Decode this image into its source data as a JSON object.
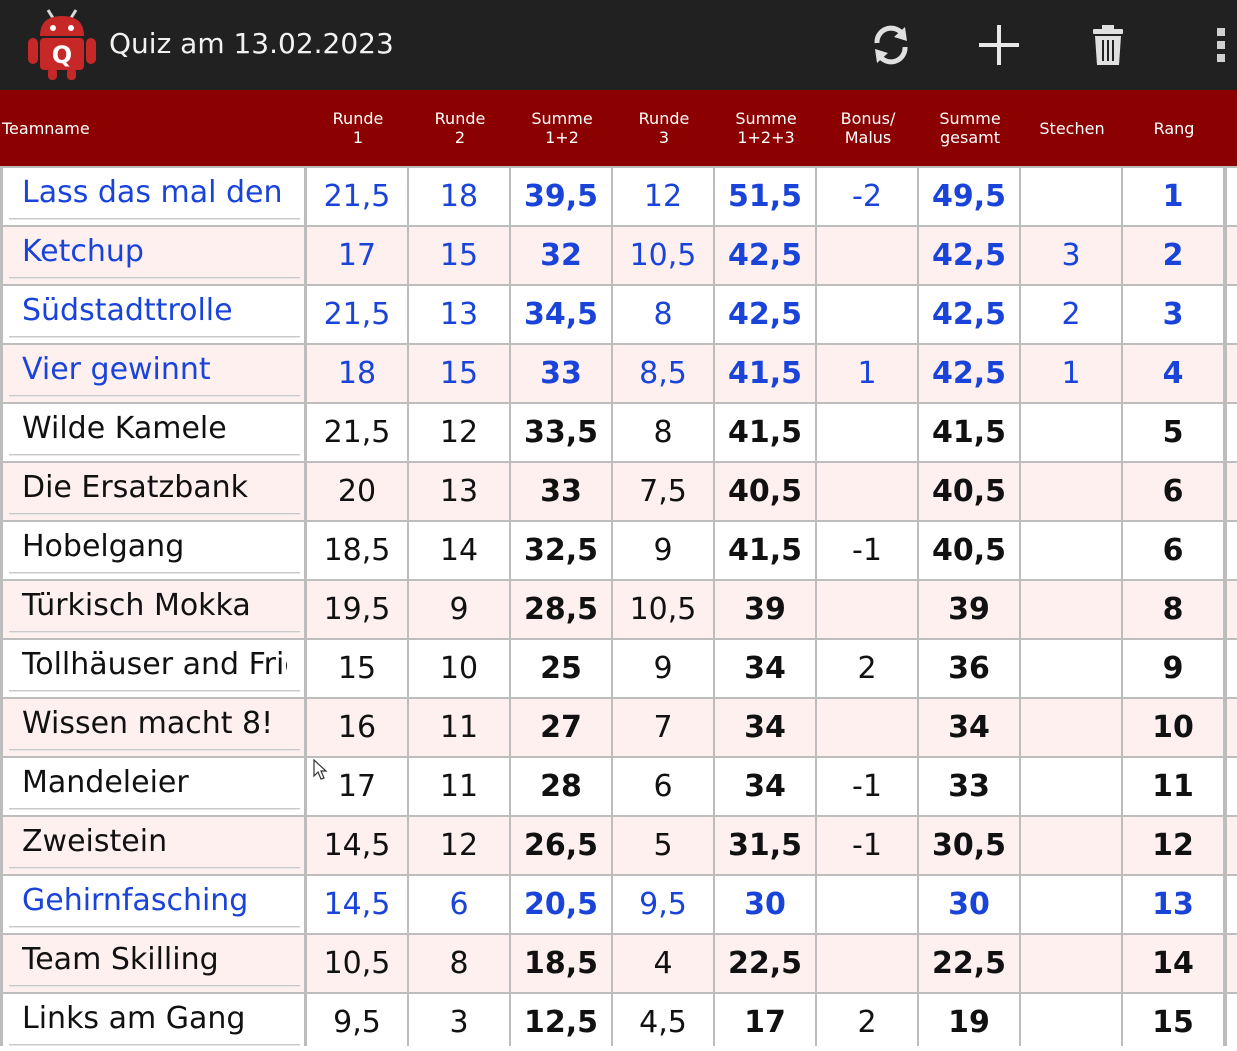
{
  "app": {
    "title": "Quiz am 13.02.2023",
    "icon_letter": "Q",
    "actions": [
      "refresh-icon",
      "add-icon",
      "delete-icon",
      "overflow-menu-icon"
    ]
  },
  "colors": {
    "appbar": "#212121",
    "header": "#8b0000",
    "row_alt": "#fff0f0",
    "highlight_text": "#1a44d9"
  },
  "table": {
    "columns": [
      "Teamname",
      "Runde\n1",
      "Runde\n2",
      "Summe\n1+2",
      "Runde\n3",
      "Summe\n1+2+3",
      "Bonus/\nMalus",
      "Summe\ngesamt",
      "Stechen",
      "Rang"
    ],
    "rows": [
      {
        "team": "Lass das mal den P",
        "r1": "21,5",
        "r2": "18",
        "s12": "39,5",
        "r3": "12",
        "s123": "51,5",
        "bonus": "-2",
        "total": "49,5",
        "stechen": "",
        "rang": "1",
        "highlight": true
      },
      {
        "team": "Ketchup",
        "r1": "17",
        "r2": "15",
        "s12": "32",
        "r3": "10,5",
        "s123": "42,5",
        "bonus": "",
        "total": "42,5",
        "stechen": "3",
        "rang": "2",
        "highlight": true
      },
      {
        "team": "Südstadttrolle",
        "r1": "21,5",
        "r2": "13",
        "s12": "34,5",
        "r3": "8",
        "s123": "42,5",
        "bonus": "",
        "total": "42,5",
        "stechen": "2",
        "rang": "3",
        "highlight": true
      },
      {
        "team": "Vier gewinnt",
        "r1": "18",
        "r2": "15",
        "s12": "33",
        "r3": "8,5",
        "s123": "41,5",
        "bonus": "1",
        "total": "42,5",
        "stechen": "1",
        "rang": "4",
        "highlight": true
      },
      {
        "team": "Wilde Kamele",
        "r1": "21,5",
        "r2": "12",
        "s12": "33,5",
        "r3": "8",
        "s123": "41,5",
        "bonus": "",
        "total": "41,5",
        "stechen": "",
        "rang": "5",
        "highlight": false
      },
      {
        "team": "Die Ersatzbank",
        "r1": "20",
        "r2": "13",
        "s12": "33",
        "r3": "7,5",
        "s123": "40,5",
        "bonus": "",
        "total": "40,5",
        "stechen": "",
        "rang": "6",
        "highlight": false
      },
      {
        "team": "Hobelgang",
        "r1": "18,5",
        "r2": "14",
        "s12": "32,5",
        "r3": "9",
        "s123": "41,5",
        "bonus": "-1",
        "total": "40,5",
        "stechen": "",
        "rang": "6",
        "highlight": false
      },
      {
        "team": "Türkisch Mokka",
        "r1": "19,5",
        "r2": "9",
        "s12": "28,5",
        "r3": "10,5",
        "s123": "39",
        "bonus": "",
        "total": "39",
        "stechen": "",
        "rang": "8",
        "highlight": false
      },
      {
        "team": "Tollhäuser and Frie",
        "r1": "15",
        "r2": "10",
        "s12": "25",
        "r3": "9",
        "s123": "34",
        "bonus": "2",
        "total": "36",
        "stechen": "",
        "rang": "9",
        "highlight": false
      },
      {
        "team": "Wissen macht 8!",
        "r1": "16",
        "r2": "11",
        "s12": "27",
        "r3": "7",
        "s123": "34",
        "bonus": "",
        "total": "34",
        "stechen": "",
        "rang": "10",
        "highlight": false
      },
      {
        "team": "Mandeleier",
        "r1": "17",
        "r2": "11",
        "s12": "28",
        "r3": "6",
        "s123": "34",
        "bonus": "-1",
        "total": "33",
        "stechen": "",
        "rang": "11",
        "highlight": false
      },
      {
        "team": "Zweistein",
        "r1": "14,5",
        "r2": "12",
        "s12": "26,5",
        "r3": "5",
        "s123": "31,5",
        "bonus": "-1",
        "total": "30,5",
        "stechen": "",
        "rang": "12",
        "highlight": false
      },
      {
        "team": "Gehirnfasching",
        "r1": "14,5",
        "r2": "6",
        "s12": "20,5",
        "r3": "9,5",
        "s123": "30",
        "bonus": "",
        "total": "30",
        "stechen": "",
        "rang": "13",
        "highlight": true
      },
      {
        "team": "Team Skilling",
        "r1": "10,5",
        "r2": "8",
        "s12": "18,5",
        "r3": "4",
        "s123": "22,5",
        "bonus": "",
        "total": "22,5",
        "stechen": "",
        "rang": "14",
        "highlight": false
      },
      {
        "team": "Links am Gang",
        "r1": "9,5",
        "r2": "3",
        "s12": "12,5",
        "r3": "4,5",
        "s123": "17",
        "bonus": "2",
        "total": "19",
        "stechen": "",
        "rang": "15",
        "highlight": false
      }
    ]
  }
}
